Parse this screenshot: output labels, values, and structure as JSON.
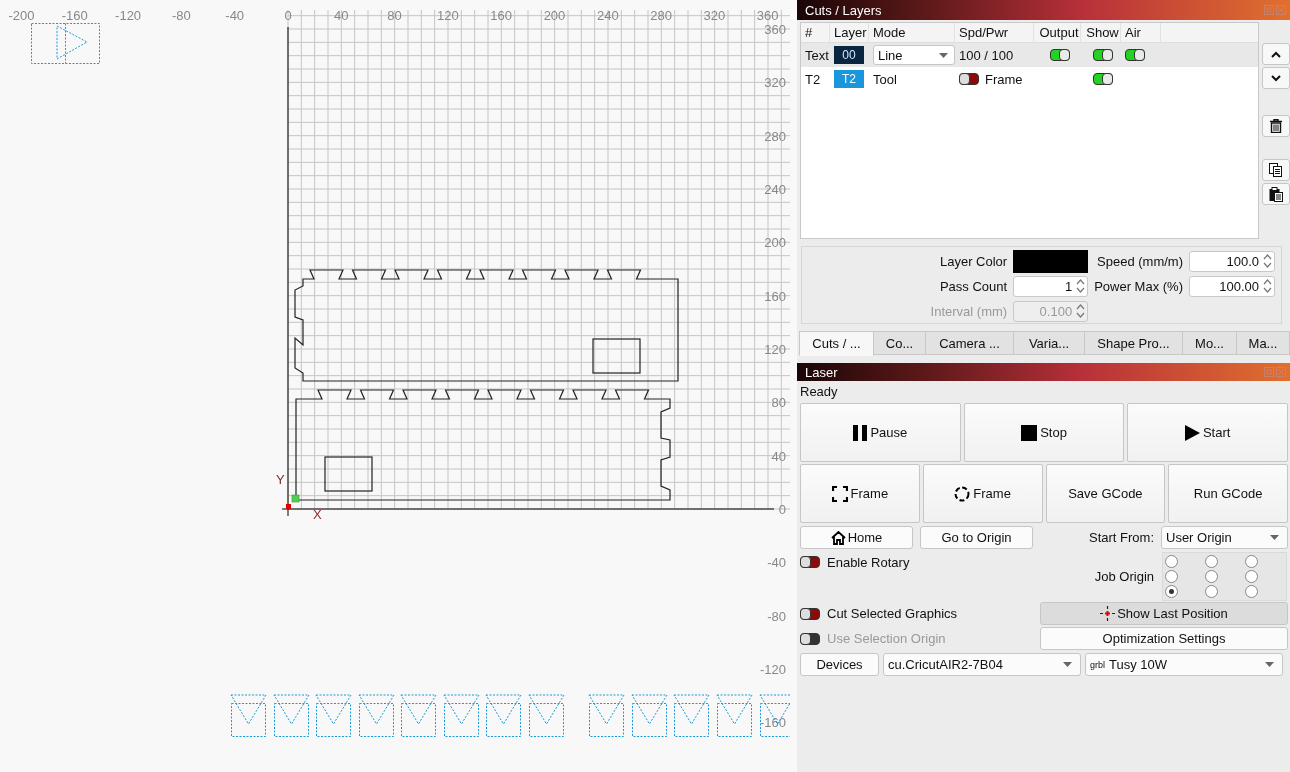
{
  "canvas": {
    "x_ruler": [
      "-200",
      "-160",
      "-120",
      "-80",
      "-40",
      "0",
      "40",
      "80",
      "120",
      "160",
      "200",
      "240",
      "280",
      "320",
      "360"
    ],
    "y_ruler": [
      "360",
      "320",
      "280",
      "240",
      "200",
      "160",
      "120",
      "80",
      "40",
      "0",
      "-40",
      "-80",
      "-120",
      "-160"
    ],
    "x_axis_label": "X",
    "y_axis_label": "Y"
  },
  "cuts_panel": {
    "title": "Cuts / Layers",
    "columns": [
      "#",
      "Layer",
      "Mode",
      "Spd/Pwr",
      "Output",
      "Show",
      "Air"
    ],
    "rows": [
      {
        "kind": "cut",
        "name": "Text",
        "layer": "00",
        "color": "#0a2540",
        "mode": "Line",
        "spd_pwr": "100 / 100",
        "output": true,
        "show": true,
        "air": true,
        "selected": true
      },
      {
        "kind": "tool",
        "name": "T2",
        "layer": "T2",
        "color": "#1a96dc",
        "mode": "Tool",
        "frame_label": "Frame",
        "frame": false,
        "show": true,
        "selected": false
      }
    ]
  },
  "properties": {
    "left": [
      {
        "kind": "color",
        "label": "Layer Color",
        "color": "#000000",
        "disabled": false
      },
      {
        "kind": "spin",
        "label": "Pass Count",
        "value": "1",
        "disabled": false
      },
      {
        "kind": "spin",
        "label": "Interval (mm)",
        "value": "0.100",
        "disabled": true
      }
    ],
    "right": [
      {
        "kind": "spin",
        "label": "Speed (mm/m)",
        "value": "100.0",
        "disabled": false
      },
      {
        "kind": "spin",
        "label": "Power Max (%)",
        "value": "100.00",
        "disabled": false
      }
    ]
  },
  "tabs": [
    {
      "label": "Cuts / ...",
      "selected": true
    },
    {
      "label": "Co...",
      "selected": false
    },
    {
      "label": "Camera ...",
      "selected": false
    },
    {
      "label": "Varia...",
      "selected": false
    },
    {
      "label": "Shape Pro...",
      "selected": false
    },
    {
      "label": "Mo...",
      "selected": false
    },
    {
      "label": "Ma...",
      "selected": false
    }
  ],
  "laser_panel": {
    "title": "Laser",
    "status": "Ready",
    "main_buttons": [
      {
        "label": "Pause",
        "kind": "pause"
      },
      {
        "label": "Stop",
        "kind": "stop"
      },
      {
        "label": "Start",
        "kind": "play"
      }
    ],
    "frame_buttons": [
      {
        "label": "Frame",
        "kind": "square"
      },
      {
        "label": "Frame",
        "kind": "circle"
      },
      {
        "label": "Save GCode",
        "kind": "plain"
      },
      {
        "label": "Run GCode",
        "kind": "plain"
      }
    ],
    "home_button": "Home",
    "origin_button": "Go to Origin",
    "start_from_label": "Start From:",
    "start_from": "User Origin",
    "enable_rotary": {
      "label": "Enable Rotary",
      "on": false
    },
    "job_origin_label": "Job Origin",
    "job_origin": [
      {
        "selected": false
      },
      {
        "selected": false
      },
      {
        "selected": false
      },
      {
        "selected": false
      },
      {
        "selected": false
      },
      {
        "selected": false
      },
      {
        "selected": true
      },
      {
        "selected": false
      },
      {
        "selected": false
      }
    ],
    "cut_selected": {
      "label": "Cut Selected Graphics",
      "on": false
    },
    "show_last_position": "Show Last Position",
    "use_selection_origin": {
      "label": "Use Selection Origin",
      "on": false,
      "disabled": true
    },
    "optimization_button": "Optimization Settings",
    "devices_button": "Devices",
    "port": "cu.CricutAIR2-7B04",
    "machine_tag": "grbl",
    "machine": "Tusy 10W"
  }
}
